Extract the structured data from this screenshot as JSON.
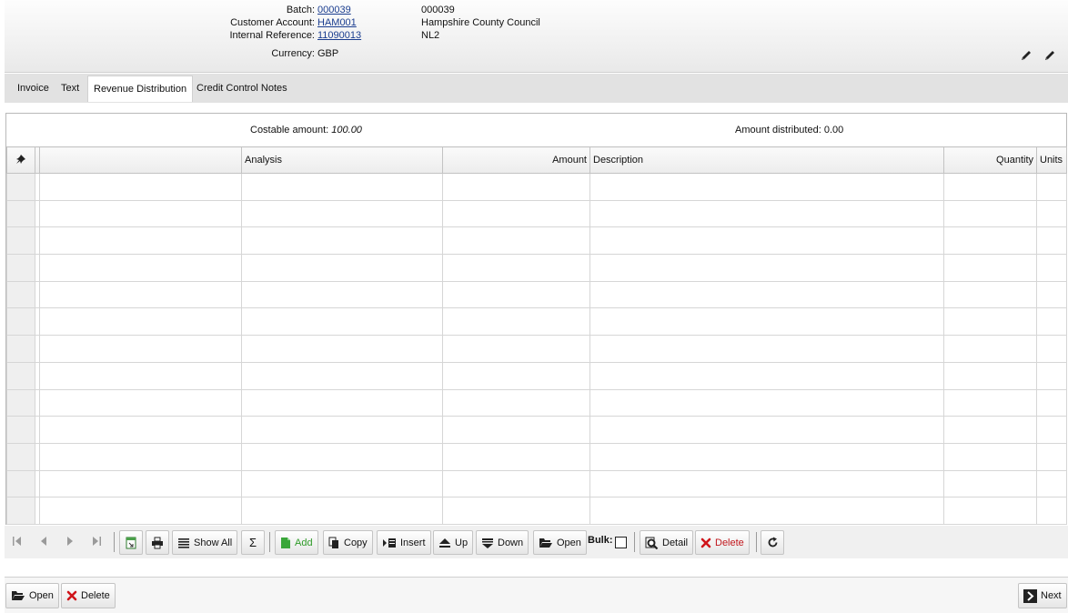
{
  "header": {
    "batch_label": "Batch:",
    "batch_link": "000039",
    "batch_value": "000039",
    "account_label": "Customer Account:",
    "account_link": "HAM001",
    "account_value": "Hampshire County Council",
    "ref_label": "Internal Reference:",
    "ref_link": "11090013",
    "ref_value": "NL2",
    "currency_label": "Currency:",
    "currency_value": "GBP"
  },
  "tabs": [
    {
      "label": "Invoice"
    },
    {
      "label": "Text"
    },
    {
      "label": "Revenue Distribution",
      "active": true
    },
    {
      "label": "Credit Control Notes"
    }
  ],
  "summary": {
    "costable_label": "Costable amount:",
    "costable_value": "100.00",
    "distributed_label": "Amount distributed:",
    "distributed_value": "0.00"
  },
  "grid": {
    "columns": [
      "",
      "Analysis",
      "Amount",
      "Description",
      "Quantity",
      "Units"
    ],
    "row_count": 13
  },
  "toolbar": {
    "show_all": "Show All",
    "sigma": "Σ",
    "add": "Add",
    "copy": "Copy",
    "insert": "Insert",
    "up": "Up",
    "down": "Down",
    "open": "Open",
    "bulk": "Bulk:",
    "detail": "Detail",
    "delete": "Delete"
  },
  "bottom": {
    "open": "Open",
    "delete": "Delete",
    "next": "Next"
  },
  "colors": {
    "link": "#1a3d8f",
    "add": "#2e9a28",
    "delete": "#c0161c"
  },
  "icons": [
    "edit-icon",
    "pin-icon",
    "first-icon",
    "prev-icon",
    "next-page-icon",
    "last-icon",
    "export-icon",
    "print-icon",
    "list-icon",
    "add-icon",
    "copy-icon",
    "insert-icon",
    "up-icon",
    "down-icon",
    "folder-icon",
    "detail-icon",
    "delete-icon",
    "refresh-icon",
    "next-arrow-icon"
  ]
}
